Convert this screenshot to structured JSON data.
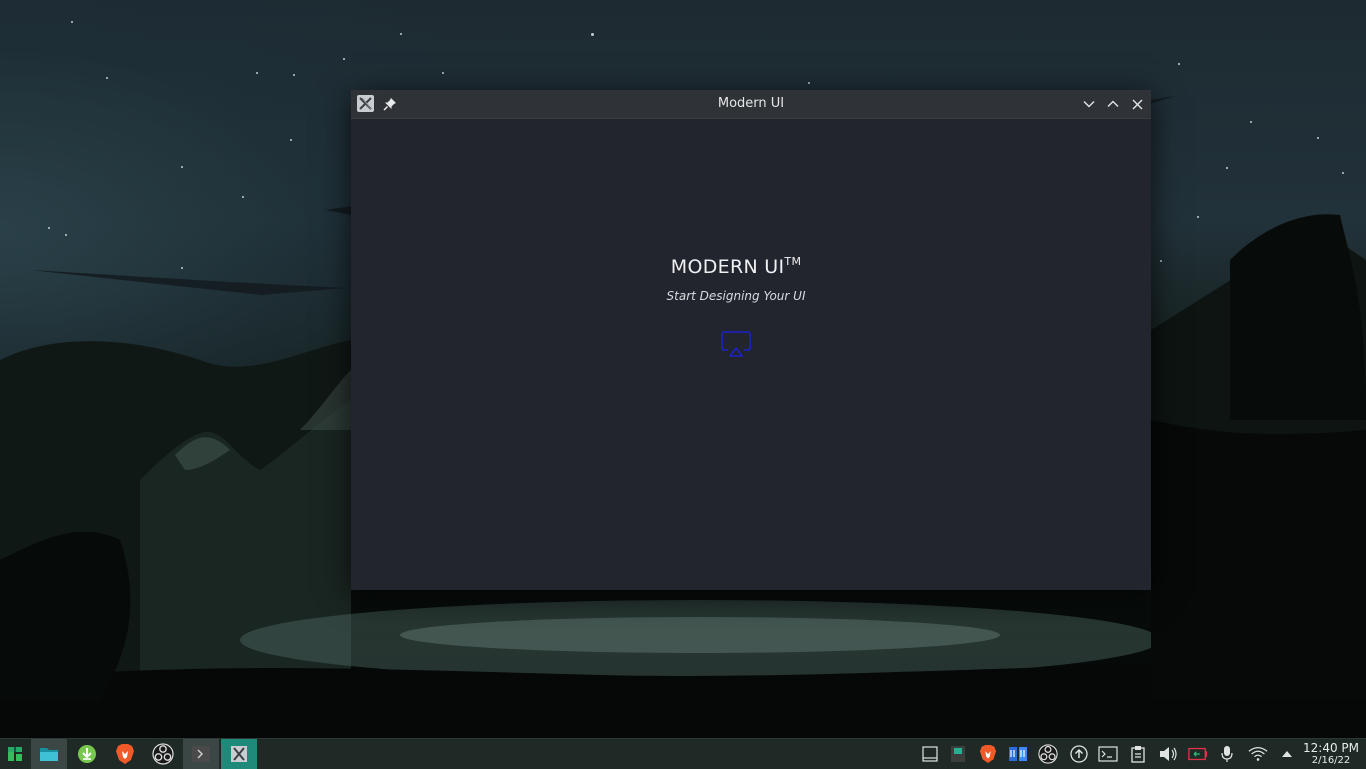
{
  "window": {
    "title": "Modern UI",
    "app_icon": "x-icon",
    "controls": [
      "pin-icon",
      "minimize-icon",
      "maximize-icon",
      "close-icon"
    ]
  },
  "content": {
    "title": "MODERN UI",
    "trademark": "TM",
    "subtitle": "Start Designing Your UI",
    "icon": "cast-icon",
    "accent_color": "#1a22c8"
  },
  "taskbar": {
    "launchers": [
      "manjaro-menu-icon",
      "file-manager-icon",
      "download-icon",
      "brave-browser-icon",
      "obs-icon",
      "terminal-icon",
      "x-app-icon"
    ],
    "tray": [
      "show-desktop-icon",
      "device-icon",
      "brave-tray-icon",
      "discover-icon",
      "obs-tray-icon",
      "update-icon",
      "terminal-tray-icon",
      "clipboard-icon",
      "volume-icon",
      "battery-icon",
      "microphone-icon",
      "wifi-icon",
      "expand-tray-icon"
    ],
    "clock": {
      "time": "12:40 PM",
      "date": "2/16/22"
    },
    "accent_color": "#1f8a79"
  }
}
